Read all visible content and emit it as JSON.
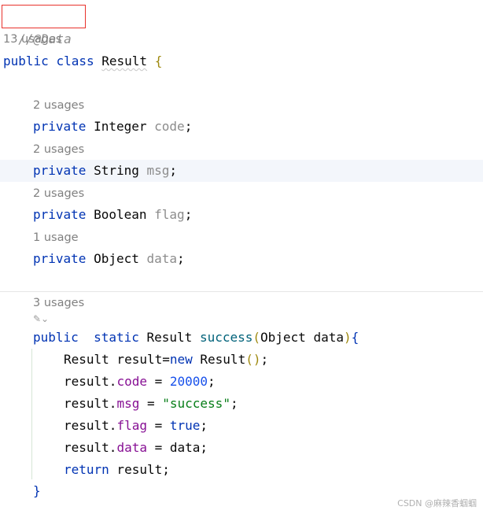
{
  "annotation": {
    "comment": "//@Data"
  },
  "hints": {
    "class_usages": "13 usages",
    "code_usages": "2 usages",
    "msg_usages": "2 usages",
    "flag_usages": "2 usages",
    "data_usages": "1 usage",
    "success_usages": "3 usages"
  },
  "code": {
    "class_decl": {
      "kw1": "public",
      "kw2": "class",
      "name": "Result",
      "brace": "{"
    },
    "fields": [
      {
        "mod": "private",
        "type": "Integer",
        "name": "code"
      },
      {
        "mod": "private",
        "type": "String",
        "name": "msg"
      },
      {
        "mod": "private",
        "type": "Boolean",
        "name": "flag"
      },
      {
        "mod": "private",
        "type": "Object",
        "name": "data"
      }
    ],
    "method": {
      "mod1": "public",
      "mod2": "static",
      "ret": "Result",
      "name": "success",
      "paren_open": "(",
      "param": "Object data",
      "paren_close": ")",
      "brace": "{"
    },
    "body": {
      "l1_a": "Result result=",
      "l1_new": "new",
      "l1_b": " Result",
      "l1_paren": "()",
      "l1_c": ";",
      "l2_a": "result.",
      "l2_f": "code",
      "l2_b": " = ",
      "l2_v": "20000",
      "l2_c": ";",
      "l3_a": "result.",
      "l3_f": "msg",
      "l3_b": " = ",
      "l3_v": "\"success\"",
      "l3_c": ";",
      "l4_a": "result.",
      "l4_f": "flag",
      "l4_b": " = ",
      "l4_v": "true",
      "l4_c": ";",
      "l5_a": "result.",
      "l5_f": "data",
      "l5_b": " = data;",
      "l6_kw": "return",
      "l6_b": " result;"
    },
    "close_brace": "}"
  },
  "watermark": "CSDN @麻辣香蝈蝈"
}
